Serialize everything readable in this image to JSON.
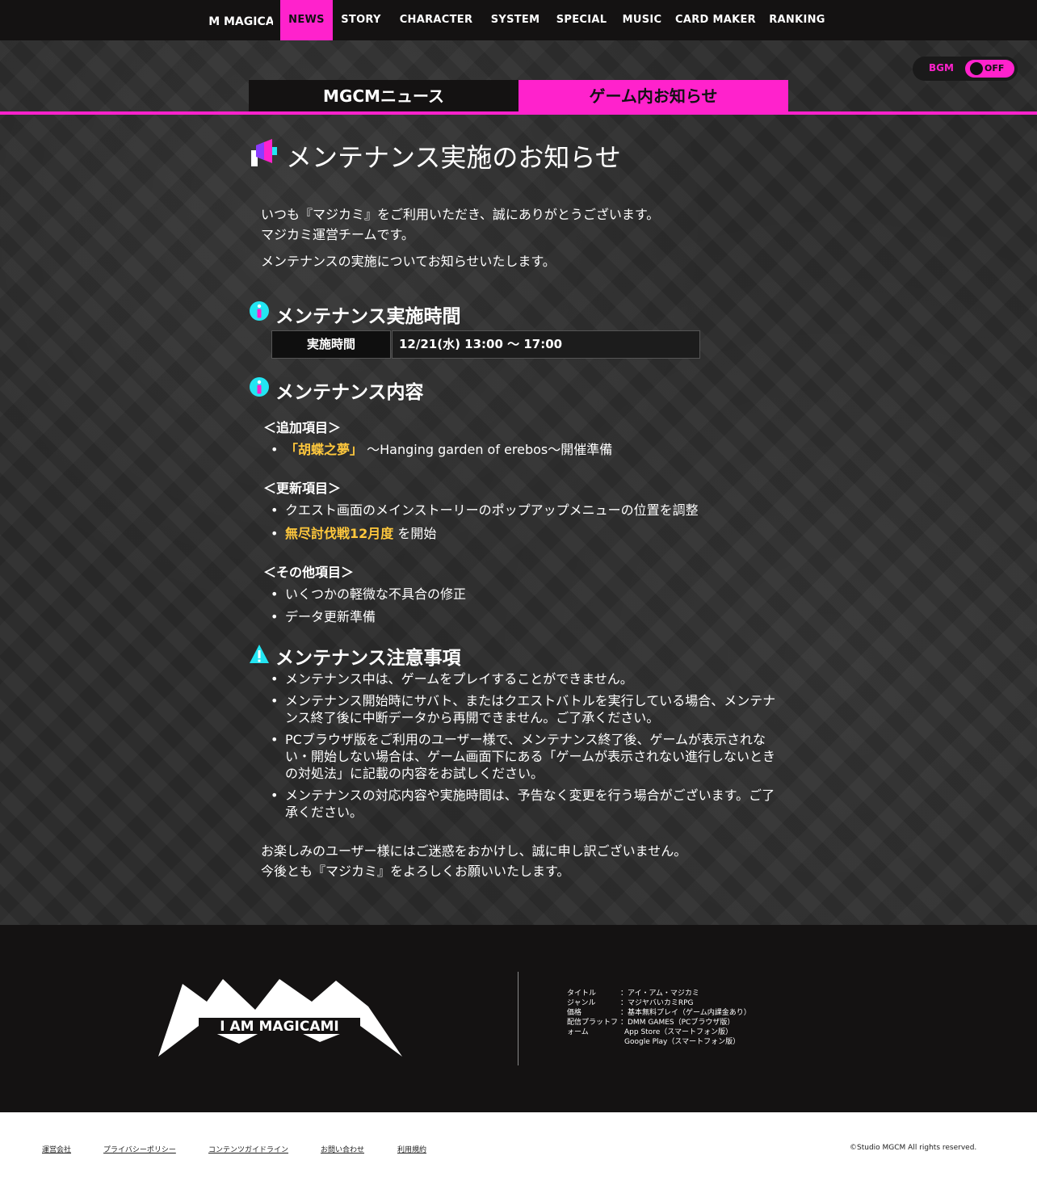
{
  "nav": {
    "logo_text": "I AM MAGICAMI",
    "items": [
      {
        "label": "NEWS"
      },
      {
        "label": "STORY"
      },
      {
        "label": "CHARACTER"
      },
      {
        "label": "SYSTEM"
      },
      {
        "label": "SPECIAL"
      },
      {
        "label": "MUSIC"
      },
      {
        "label": "CARD MAKER"
      },
      {
        "label": "RANKING"
      }
    ],
    "active_index": 0
  },
  "bgm": {
    "label": "BGM",
    "state": "OFF"
  },
  "tabs": [
    {
      "label": "MGCMニュース",
      "active": false
    },
    {
      "label": "ゲーム内お知らせ",
      "active": true
    }
  ],
  "article": {
    "title": "メンテナンス実施のお知らせ",
    "intro": [
      "いつも『マジカミ』をご利用いただき、誠にありがとうございます。",
      "マジカミ運営チームです。",
      "メンテナンスの実施についてお知らせいたします。"
    ],
    "sections": {
      "time": {
        "title": "メンテナンス実施時間",
        "header": "実施時間",
        "value": "12/21(水) 13:00 ～ 17:00"
      },
      "content": {
        "title": "メンテナンス内容",
        "added": {
          "label": "＜追加項目＞",
          "item_highlight": "「胡蝶之夢」",
          "item_rest": "～Hanging garden of erebos～開催準備"
        },
        "updated": {
          "label": "＜更新項目＞",
          "item1": "クエスト画面のメインストーリーのポップアップメニューの位置を調整",
          "item2_highlight": "無尽討伐戦12月度",
          "item2_rest": "を開始"
        },
        "other": {
          "label": "＜その他項目＞",
          "item1": "いくつかの軽微な不具合の修正",
          "item2": "データ更新準備"
        }
      },
      "notes": {
        "title": "メンテナンス注意事項",
        "items": [
          "メンテナンス中は、ゲームをプレイすることができません。",
          "メンテナンス開始時にサバト、またはクエストバトルを実行している場合、メンテナンス終了後に中断データから再開できません。ご了承ください。",
          "PCブラウザ版をご利用のユーザー様で、メンテナンス終了後、ゲームが表示されない・開始しない場合は、ゲーム画面下にある「ゲームが表示されない進行しないときの対処法」に記載の内容をお試しください。",
          "メンテナンスの対応内容や実施時間は、予告なく変更を行う場合がございます。ご了承ください。"
        ]
      }
    },
    "closing": [
      "お楽しみのユーザー様にはご迷惑をおかけし、誠に申し訳ございません。",
      "今後とも『マジカミ』をよろしくお願いいたします。"
    ]
  },
  "footer": {
    "logo_text": "I AM MAGICAMI",
    "info": [
      {
        "key": "タイトル",
        "value": "：アイ・アム・マジカミ"
      },
      {
        "key": "ジャンル",
        "value": "：マジヤバいカミRPG"
      },
      {
        "key": "価格",
        "value": "：基本無料プレイ（ゲーム内課金あり）"
      },
      {
        "key": "配信プラットフォーム",
        "value": "：DMM GAMES（PCブラウザ版）"
      },
      {
        "key": "",
        "value": "App Store（スマートフォン版）"
      },
      {
        "key": "",
        "value": "Google Play（スマートフォン版）"
      }
    ],
    "links": [
      "運営会社",
      "プライバシーポリシー",
      "コンテンツガイドライン",
      "お問い合わせ",
      "利用規約"
    ],
    "copyright": "©Studio MGCM All rights reserved."
  },
  "colors": {
    "accent": "#ff22cc",
    "highlight": "#ffc83d",
    "info_icon": "#22e5f2",
    "dark": "#141212"
  }
}
